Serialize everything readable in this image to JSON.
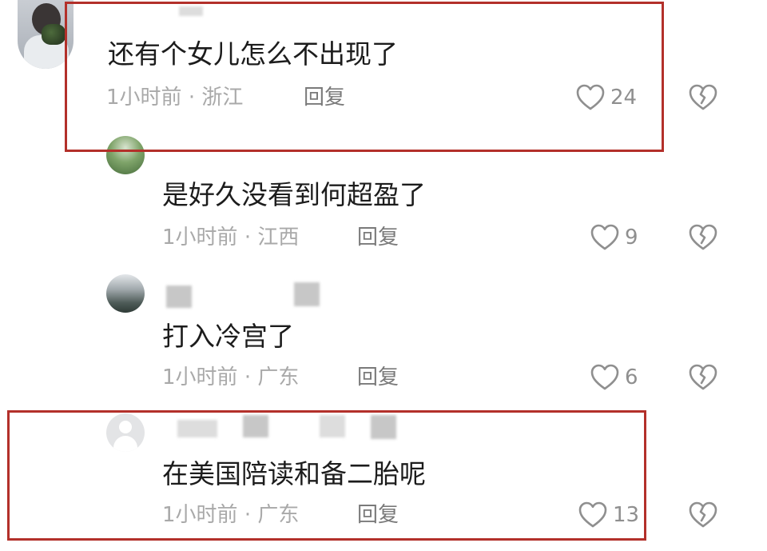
{
  "comments": [
    {
      "text": "还有个女儿怎么不出现了",
      "time": "1小时前",
      "separator": "·",
      "location": "浙江",
      "reply": "回复",
      "likes": "24",
      "avatar": "photo-person-with-flowers",
      "highlighted": true
    },
    {
      "text": "是好久没看到何超盈了",
      "time": "1小时前",
      "separator": "·",
      "location": "江西",
      "reply": "回复",
      "likes": "9",
      "avatar": "photo-green-landscape",
      "highlighted": false
    },
    {
      "text": "打入冷宫了",
      "time": "1小时前",
      "separator": "·",
      "location": "广东",
      "reply": "回复",
      "likes": "6",
      "avatar": "photo-waterside-town",
      "highlighted": false
    },
    {
      "text": "在美国陪读和备二胎呢",
      "time": "1小时前",
      "separator": "·",
      "location": "广东",
      "reply": "回复",
      "likes": "13",
      "avatar": "default-user-icon",
      "highlighted": true
    }
  ],
  "icons": {
    "like": "heart-outline-icon",
    "dislike": "broken-heart-icon"
  },
  "colors": {
    "highlight_border": "#b3302a",
    "meta_text": "#a9a9a9",
    "reply_text": "#7a7a7a",
    "comment_text": "#1c1c1c"
  }
}
